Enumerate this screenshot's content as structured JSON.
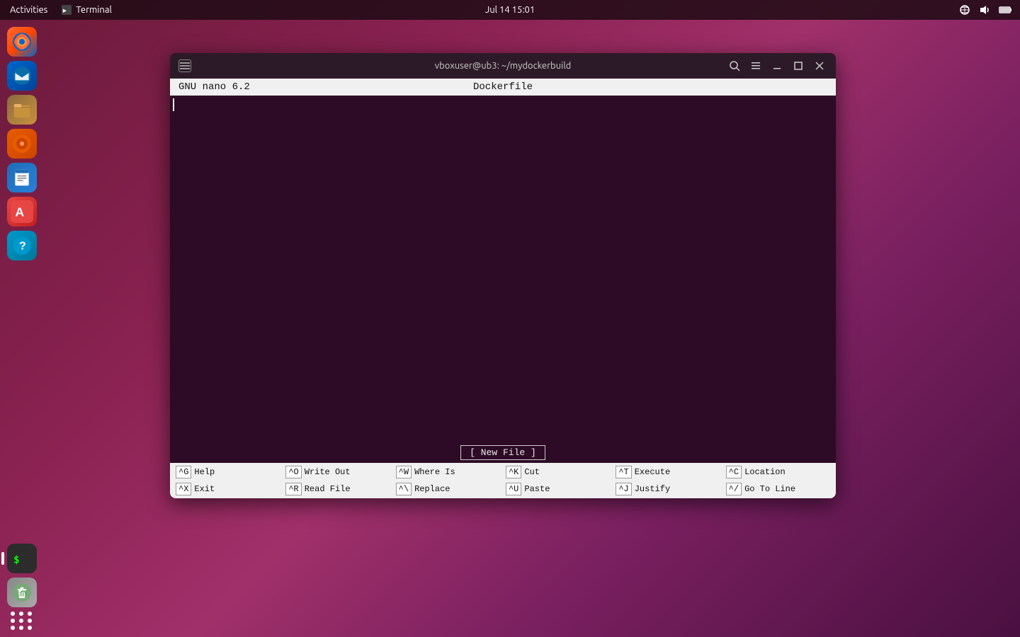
{
  "topbar": {
    "activities": "Activities",
    "terminal_label": "Terminal",
    "datetime": "Jul 14  15:01"
  },
  "terminal": {
    "title": "vboxuser@ub3: ~/mydockerbuild",
    "window_icon": "⬛"
  },
  "nano": {
    "header_left": "GNU nano 6.2",
    "header_center": "Dockerfile",
    "header_right": "",
    "new_file_banner": "[ New File ]",
    "shortcuts": [
      {
        "row1_key": "^G",
        "row1_label": "Help",
        "row2_key": "^X",
        "row2_label": "Exit"
      },
      {
        "row1_key": "^O",
        "row1_label": "Write Out",
        "row2_key": "^R",
        "row2_label": "Read File"
      },
      {
        "row1_key": "^W",
        "row1_label": "Where Is",
        "row2_key": "^\\",
        "row2_label": "Replace"
      },
      {
        "row1_key": "^K",
        "row1_label": "Cut",
        "row2_key": "^U",
        "row2_label": "Paste"
      },
      {
        "row1_key": "^T",
        "row1_label": "Execute",
        "row2_key": "^J",
        "row2_label": "Justify"
      },
      {
        "row1_key": "^C",
        "row1_label": "Location",
        "row2_key": "^/",
        "row2_label": "Go To Line"
      }
    ]
  },
  "sidebar": {
    "apps": [
      {
        "name": "firefox",
        "icon": "🦊",
        "active": false
      },
      {
        "name": "thunderbird",
        "icon": "🐦",
        "active": false
      },
      {
        "name": "files",
        "icon": "📁",
        "active": false
      },
      {
        "name": "rhythmbox",
        "icon": "🎵",
        "active": false
      },
      {
        "name": "writer",
        "icon": "📝",
        "active": false
      },
      {
        "name": "appstore",
        "icon": "🅐",
        "active": false
      },
      {
        "name": "help",
        "icon": "❓",
        "active": false
      },
      {
        "name": "terminal",
        "icon": ">_",
        "active": true
      },
      {
        "name": "trash",
        "icon": "♻",
        "active": false
      }
    ]
  }
}
